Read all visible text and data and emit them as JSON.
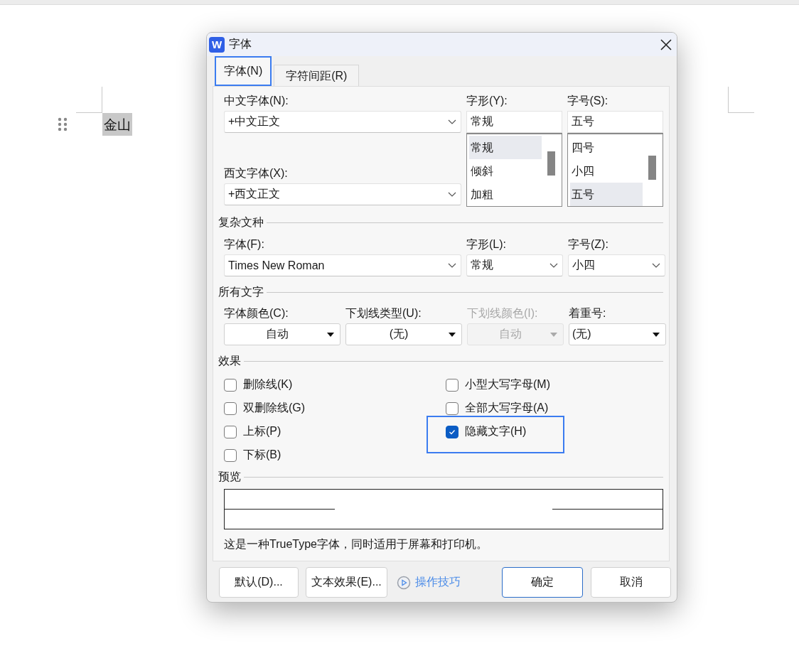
{
  "document": {
    "text": "金山"
  },
  "dialog": {
    "icon_text": "W",
    "title": "字体",
    "tabs": [
      {
        "label": "字体(N)",
        "selected": true
      },
      {
        "label": "字符间距(R)",
        "selected": false
      }
    ],
    "chinese_font": {
      "label": "中文字体(N):",
      "value": "+中文正文"
    },
    "western_font": {
      "label": "西文字体(X):",
      "value": "+西文正文"
    },
    "style": {
      "label": "字形(Y):",
      "value": "常规",
      "options": [
        {
          "text": "常规",
          "selected": true
        },
        {
          "text": "倾斜",
          "selected": false
        },
        {
          "text": "加粗",
          "selected": false
        }
      ]
    },
    "size": {
      "label": "字号(S):",
      "value": "五号",
      "options": [
        {
          "text": "四号",
          "selected": false
        },
        {
          "text": "小四",
          "selected": false
        },
        {
          "text": "五号",
          "selected": true
        }
      ]
    },
    "complex_section": "复杂文种",
    "complex": [
      {
        "label": "字体(F):",
        "value": "Times New Roman"
      },
      {
        "label": "字形(L):",
        "value": "常规"
      },
      {
        "label": "字号(Z):",
        "value": "小四"
      }
    ],
    "all_text_section": "所有文字",
    "all_text": [
      {
        "label": "字体颜色(C):",
        "value": "自动",
        "disabled": false
      },
      {
        "label": "下划线类型(U):",
        "value": "(无)",
        "disabled": false
      },
      {
        "label": "下划线颜色(I):",
        "value": "自动",
        "disabled": true
      },
      {
        "label": "着重号:",
        "value": "(无)",
        "disabled": false
      }
    ],
    "effects_section": "效果",
    "effects": [
      {
        "label": "删除线(K)",
        "checked": false,
        "focused": false
      },
      {
        "label": "双删除线(G)",
        "checked": false,
        "focused": false
      },
      {
        "label": "上标(P)",
        "checked": false,
        "focused": false
      },
      {
        "label": "下标(B)",
        "checked": false,
        "focused": false
      },
      {
        "label": "小型大写字母(M)",
        "checked": false,
        "focused": false
      },
      {
        "label": "全部大写字母(A)",
        "checked": false,
        "focused": false
      },
      {
        "label": "隐藏文字(H)",
        "checked": true,
        "focused": true
      }
    ],
    "preview_section": "预览",
    "description": "这是一种TrueType字体，同时适用于屏幕和打印机。",
    "buttons": [
      {
        "label": "默认(D)...",
        "kind": "button"
      },
      {
        "label": "文本效果(E)...",
        "kind": "button"
      },
      {
        "label": "操作技巧",
        "kind": "link"
      },
      {
        "label": "确定",
        "kind": "primary"
      },
      {
        "label": "取消",
        "kind": "button"
      }
    ]
  }
}
